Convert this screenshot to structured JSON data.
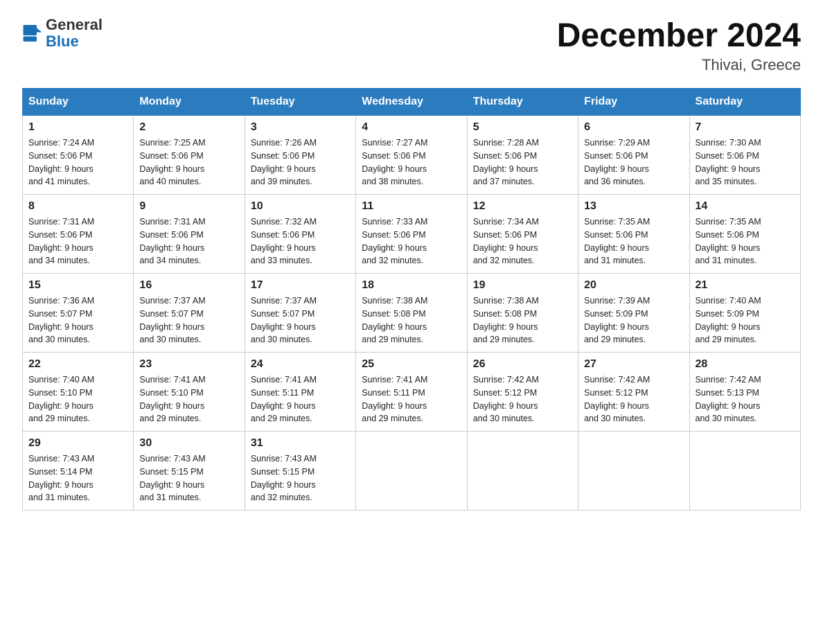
{
  "header": {
    "logo_line1": "General",
    "logo_line2": "Blue",
    "calendar_title": "December 2024",
    "calendar_subtitle": "Thivai, Greece"
  },
  "days_of_week": [
    "Sunday",
    "Monday",
    "Tuesday",
    "Wednesday",
    "Thursday",
    "Friday",
    "Saturday"
  ],
  "weeks": [
    [
      {
        "day": "1",
        "sunrise": "7:24 AM",
        "sunset": "5:06 PM",
        "daylight": "9 hours and 41 minutes."
      },
      {
        "day": "2",
        "sunrise": "7:25 AM",
        "sunset": "5:06 PM",
        "daylight": "9 hours and 40 minutes."
      },
      {
        "day": "3",
        "sunrise": "7:26 AM",
        "sunset": "5:06 PM",
        "daylight": "9 hours and 39 minutes."
      },
      {
        "day": "4",
        "sunrise": "7:27 AM",
        "sunset": "5:06 PM",
        "daylight": "9 hours and 38 minutes."
      },
      {
        "day": "5",
        "sunrise": "7:28 AM",
        "sunset": "5:06 PM",
        "daylight": "9 hours and 37 minutes."
      },
      {
        "day": "6",
        "sunrise": "7:29 AM",
        "sunset": "5:06 PM",
        "daylight": "9 hours and 36 minutes."
      },
      {
        "day": "7",
        "sunrise": "7:30 AM",
        "sunset": "5:06 PM",
        "daylight": "9 hours and 35 minutes."
      }
    ],
    [
      {
        "day": "8",
        "sunrise": "7:31 AM",
        "sunset": "5:06 PM",
        "daylight": "9 hours and 34 minutes."
      },
      {
        "day": "9",
        "sunrise": "7:31 AM",
        "sunset": "5:06 PM",
        "daylight": "9 hours and 34 minutes."
      },
      {
        "day": "10",
        "sunrise": "7:32 AM",
        "sunset": "5:06 PM",
        "daylight": "9 hours and 33 minutes."
      },
      {
        "day": "11",
        "sunrise": "7:33 AM",
        "sunset": "5:06 PM",
        "daylight": "9 hours and 32 minutes."
      },
      {
        "day": "12",
        "sunrise": "7:34 AM",
        "sunset": "5:06 PM",
        "daylight": "9 hours and 32 minutes."
      },
      {
        "day": "13",
        "sunrise": "7:35 AM",
        "sunset": "5:06 PM",
        "daylight": "9 hours and 31 minutes."
      },
      {
        "day": "14",
        "sunrise": "7:35 AM",
        "sunset": "5:06 PM",
        "daylight": "9 hours and 31 minutes."
      }
    ],
    [
      {
        "day": "15",
        "sunrise": "7:36 AM",
        "sunset": "5:07 PM",
        "daylight": "9 hours and 30 minutes."
      },
      {
        "day": "16",
        "sunrise": "7:37 AM",
        "sunset": "5:07 PM",
        "daylight": "9 hours and 30 minutes."
      },
      {
        "day": "17",
        "sunrise": "7:37 AM",
        "sunset": "5:07 PM",
        "daylight": "9 hours and 30 minutes."
      },
      {
        "day": "18",
        "sunrise": "7:38 AM",
        "sunset": "5:08 PM",
        "daylight": "9 hours and 29 minutes."
      },
      {
        "day": "19",
        "sunrise": "7:38 AM",
        "sunset": "5:08 PM",
        "daylight": "9 hours and 29 minutes."
      },
      {
        "day": "20",
        "sunrise": "7:39 AM",
        "sunset": "5:09 PM",
        "daylight": "9 hours and 29 minutes."
      },
      {
        "day": "21",
        "sunrise": "7:40 AM",
        "sunset": "5:09 PM",
        "daylight": "9 hours and 29 minutes."
      }
    ],
    [
      {
        "day": "22",
        "sunrise": "7:40 AM",
        "sunset": "5:10 PM",
        "daylight": "9 hours and 29 minutes."
      },
      {
        "day": "23",
        "sunrise": "7:41 AM",
        "sunset": "5:10 PM",
        "daylight": "9 hours and 29 minutes."
      },
      {
        "day": "24",
        "sunrise": "7:41 AM",
        "sunset": "5:11 PM",
        "daylight": "9 hours and 29 minutes."
      },
      {
        "day": "25",
        "sunrise": "7:41 AM",
        "sunset": "5:11 PM",
        "daylight": "9 hours and 29 minutes."
      },
      {
        "day": "26",
        "sunrise": "7:42 AM",
        "sunset": "5:12 PM",
        "daylight": "9 hours and 30 minutes."
      },
      {
        "day": "27",
        "sunrise": "7:42 AM",
        "sunset": "5:12 PM",
        "daylight": "9 hours and 30 minutes."
      },
      {
        "day": "28",
        "sunrise": "7:42 AM",
        "sunset": "5:13 PM",
        "daylight": "9 hours and 30 minutes."
      }
    ],
    [
      {
        "day": "29",
        "sunrise": "7:43 AM",
        "sunset": "5:14 PM",
        "daylight": "9 hours and 31 minutes."
      },
      {
        "day": "30",
        "sunrise": "7:43 AM",
        "sunset": "5:15 PM",
        "daylight": "9 hours and 31 minutes."
      },
      {
        "day": "31",
        "sunrise": "7:43 AM",
        "sunset": "5:15 PM",
        "daylight": "9 hours and 32 minutes."
      },
      {
        "day": "",
        "sunrise": "",
        "sunset": "",
        "daylight": ""
      },
      {
        "day": "",
        "sunrise": "",
        "sunset": "",
        "daylight": ""
      },
      {
        "day": "",
        "sunrise": "",
        "sunset": "",
        "daylight": ""
      },
      {
        "day": "",
        "sunrise": "",
        "sunset": "",
        "daylight": ""
      }
    ]
  ],
  "labels": {
    "sunrise_prefix": "Sunrise: ",
    "sunset_prefix": "Sunset: ",
    "daylight_prefix": "Daylight: "
  },
  "colors": {
    "header_bg": "#2b7bbf",
    "logo_blue": "#1a6fb5"
  }
}
